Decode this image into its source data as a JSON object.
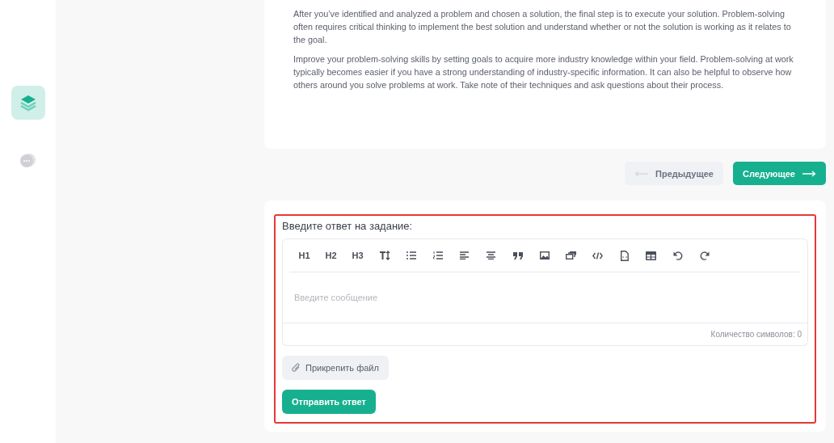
{
  "sidebar": {
    "items": [
      {
        "selected": true
      },
      {
        "selected": false
      }
    ]
  },
  "article": {
    "paragraphs": [
      "After you’ve identified and analyzed a problem and chosen a solution, the final step is to execute your solution. Problem-solving often requires critical thinking to implement the best solution and understand whether or not the solution is working as it relates to the goal.",
      "Improve your problem-solving skills by setting goals to acquire more industry knowledge within your field. Problem-solving at work typically becomes easier if you have a strong understanding of industry-specific information. It can also be helpful to observe how others around you solve problems at work. Take note of their techniques and ask questions about their process."
    ]
  },
  "navigation": [
    {
      "label": "Предыдущее",
      "kind": "prev",
      "disabled": true
    },
    {
      "label": "Следующее",
      "kind": "next",
      "disabled": false
    }
  ],
  "answer": {
    "title": "Введите ответ на задание:",
    "toolbar": [
      "H1",
      "H2",
      "H3"
    ],
    "placeholder": "Введите сообщение",
    "char_count": "Количество символов: 0",
    "attach_button": "Прикрепить файл",
    "submit_button": "Отправить ответ"
  }
}
